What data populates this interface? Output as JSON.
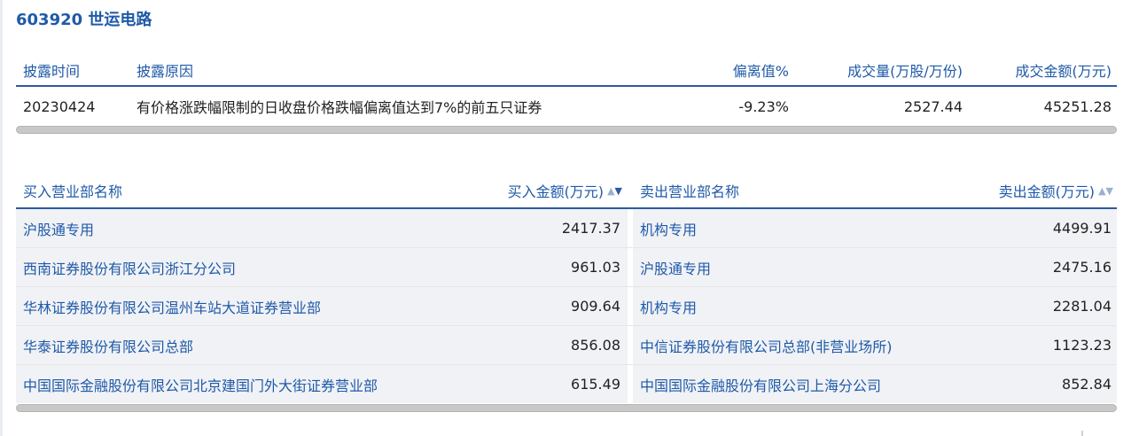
{
  "stock": {
    "title": "603920 世运电路"
  },
  "summary": {
    "headers": {
      "date": "披露时间",
      "reason": "披露原因",
      "deviation": "偏离值%",
      "volume": "成交量(万股/万份)",
      "amount": "成交金额(万元)"
    },
    "row": {
      "date": "20230424",
      "reason": "有价格涨跌幅限制的日收盘价格跌幅偏离值达到7%的前五只证券",
      "deviation": "-9.23%",
      "volume": "2527.44",
      "amount": "45251.28"
    }
  },
  "details": {
    "headers": {
      "buy_name": "买入营业部名称",
      "buy_amount": "买入金额(万元)",
      "sell_name": "卖出营业部名称",
      "sell_amount": "卖出金额(万元)"
    },
    "sort_icon": {
      "up": "▲",
      "down": "▼"
    },
    "rows": [
      {
        "buy_name": "沪股通专用",
        "buy_amount": "2417.37",
        "sell_name": "机构专用",
        "sell_amount": "4499.91"
      },
      {
        "buy_name": "西南证券股份有限公司浙江分公司",
        "buy_amount": "961.03",
        "sell_name": "沪股通专用",
        "sell_amount": "2475.16"
      },
      {
        "buy_name": "华林证券股份有限公司温州车站大道证券营业部",
        "buy_amount": "909.64",
        "sell_name": "机构专用",
        "sell_amount": "2281.04"
      },
      {
        "buy_name": "华泰证券股份有限公司总部",
        "buy_amount": "856.08",
        "sell_name": "中信证券股份有限公司总部(非营业场所)",
        "sell_amount": "1123.23"
      },
      {
        "buy_name": "中国国际金融股份有限公司北京建国门外大街证券营业部",
        "buy_amount": "615.49",
        "sell_name": "中国国际金融股份有限公司上海分公司",
        "sell_amount": "852.84"
      }
    ]
  },
  "colors": {
    "link": "#1f5aa8",
    "header_rule": "#2d5aa0",
    "row_bg": "#f1f2f6"
  }
}
